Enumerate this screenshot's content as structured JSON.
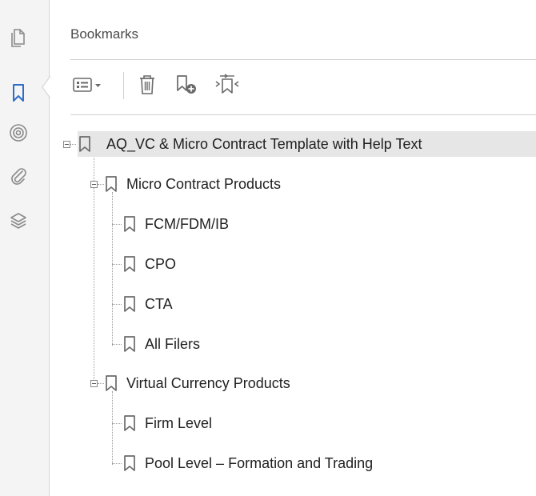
{
  "panel": {
    "title": "Bookmarks"
  },
  "rail": {
    "icons": [
      "pages-icon",
      "bookmark-icon",
      "signatures-icon",
      "attachments-icon",
      "layers-icon"
    ],
    "active": "bookmark-icon",
    "accent": "#2d6ec9"
  },
  "toolbar": {
    "icons": [
      "options-menu-icon",
      "delete-icon",
      "new-bookmark-icon",
      "expand-bookmark-icon"
    ]
  },
  "bookmarks": {
    "root": "AQ_VC & Micro Contract Template with Help Text",
    "groups": [
      {
        "label": "Micro Contract Products",
        "children": [
          "FCM/FDM/IB",
          "CPO",
          "CTA",
          "All Filers"
        ]
      },
      {
        "label": "Virtual Currency Products",
        "children": [
          "Firm Level",
          "Pool Level – Formation and Trading"
        ]
      }
    ]
  },
  "colors": {
    "selected_row": "#e6e6e6",
    "rail_bg": "#f4f4f4",
    "icon_gray": "#7a7a7a"
  }
}
